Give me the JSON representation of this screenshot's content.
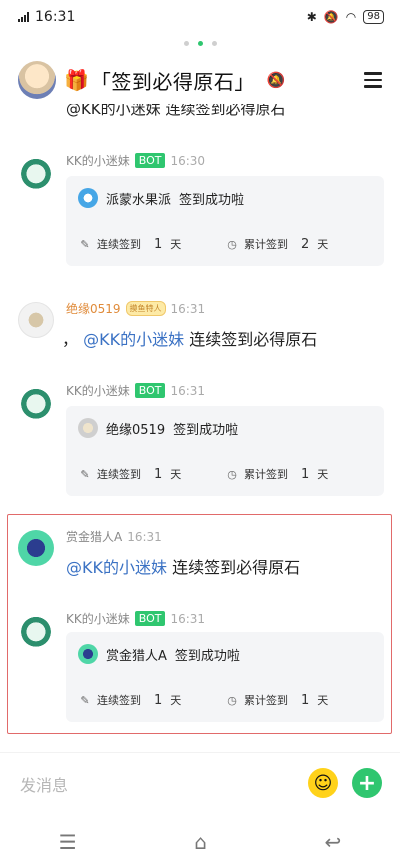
{
  "status_bar": {
    "time": "16:31",
    "battery": "98"
  },
  "header": {
    "gift_icon": "🎁",
    "title": "「签到必得原石」"
  },
  "partial_message": {
    "mention": "@KK的小迷妹",
    "text": "连续签到必得原石"
  },
  "messages": [
    {
      "name": "KK的小迷妹",
      "badge": "BOT",
      "time": "16:30",
      "card": {
        "user": "派蒙水果派",
        "action": "签到成功啦",
        "streak_label": "连续签到",
        "streak_value": "1",
        "streak_unit": "天",
        "total_label": "累计签到",
        "total_value": "2",
        "total_unit": "天"
      }
    },
    {
      "name": "绝缘0519",
      "badge": "摸鱼特人",
      "time": "16:31",
      "prefix": "，",
      "mention": "@KK的小迷妹",
      "text": "连续签到必得原石"
    },
    {
      "name": "KK的小迷妹",
      "badge": "BOT",
      "time": "16:31",
      "card": {
        "user": "绝缘0519",
        "action": "签到成功啦",
        "streak_label": "连续签到",
        "streak_value": "1",
        "streak_unit": "天",
        "total_label": "累计签到",
        "total_value": "1",
        "total_unit": "天"
      }
    },
    {
      "name": "赏金猎人A",
      "time": "16:31",
      "mention": "@KK的小迷妹",
      "text": "连续签到必得原石"
    },
    {
      "name": "KK的小迷妹",
      "badge": "BOT",
      "time": "16:31",
      "card": {
        "user": "赏金猎人A",
        "action": "签到成功啦",
        "streak_label": "连续签到",
        "streak_value": "1",
        "streak_unit": "天",
        "total_label": "累计签到",
        "total_value": "1",
        "total_unit": "天"
      }
    }
  ],
  "input": {
    "placeholder": "发消息"
  },
  "colors": {
    "accent": "#2fc66f",
    "mention": "#3b72c4",
    "highlight": "#e16a6a"
  }
}
